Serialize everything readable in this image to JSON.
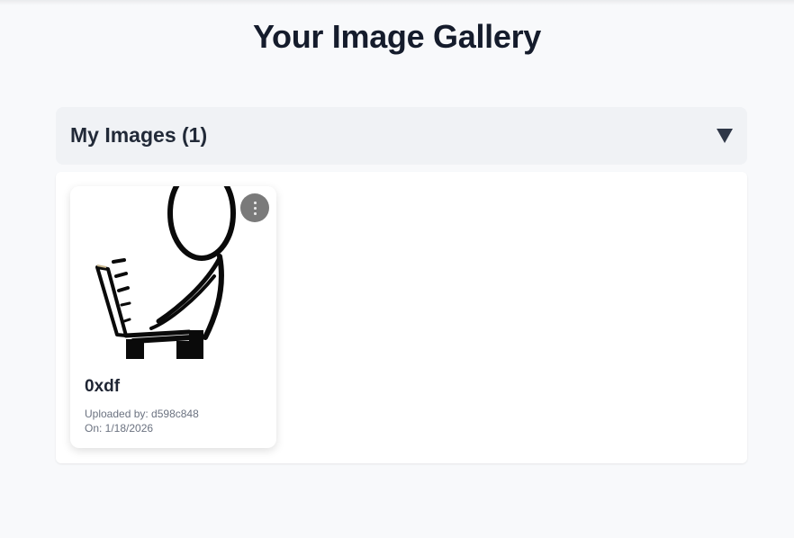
{
  "page": {
    "title": "Your Image Gallery"
  },
  "section": {
    "title": "My Images (1)",
    "toggle_icon": "triangle-down-icon",
    "expanded": true
  },
  "images": [
    {
      "name": "0xdf",
      "uploaded_by": "Uploaded by: d598c848",
      "date": "On: 1/18/2026",
      "thumbnail": "stick-figure-with-laptop-drawing",
      "menu_icon": "vertical-ellipsis-icon"
    }
  ],
  "colors": {
    "page_bg": "#f8f9fb",
    "header_bg": "#f0f2f5",
    "title_text": "#151c2c",
    "menu_button_bg": "#7a7a7a",
    "meta_text": "#6b7280"
  }
}
